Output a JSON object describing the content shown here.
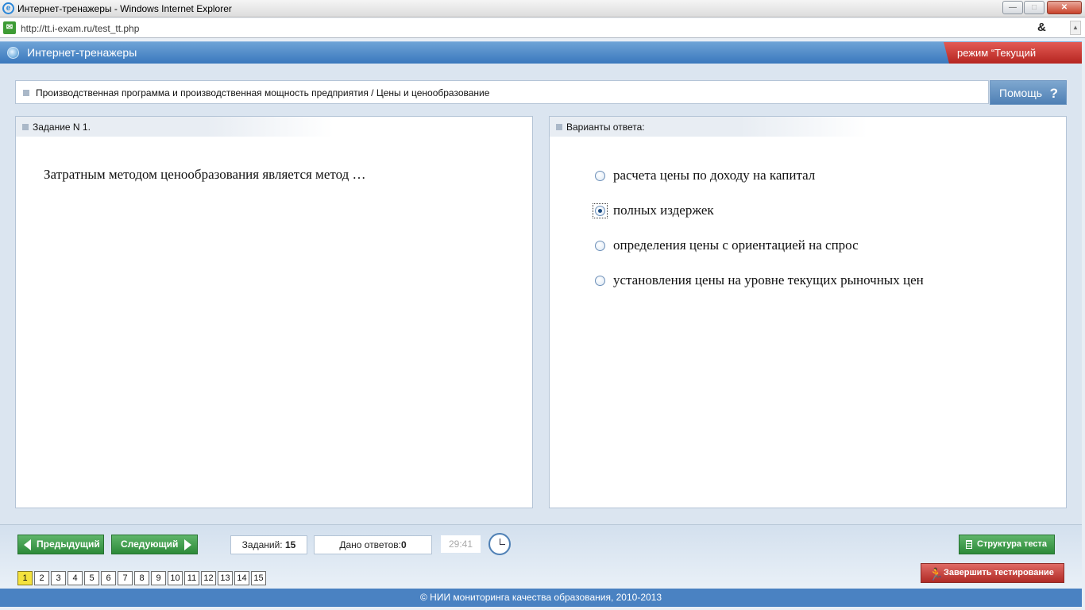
{
  "window": {
    "title": "Интернет-тренажеры - Windows Internet Explorer",
    "min": "—",
    "max": "□",
    "close": "✕"
  },
  "address": {
    "url": "http://tt.i-exam.ru/test_tt.php"
  },
  "header": {
    "title": "Интернет-тренажеры",
    "mode": "режим “Текущий контроль”"
  },
  "breadcrumb": {
    "text": "Производственная программа и производственная мощность предприятия / Цены и ценообразование"
  },
  "help": {
    "label": "Помощь",
    "icon": "?"
  },
  "question_panel": {
    "title": "Задание N 1.",
    "text": "Затратным методом ценообразования является метод …"
  },
  "answers_panel": {
    "title": "Варианты ответа:",
    "options": [
      {
        "label": "расчета цены по доходу на капитал",
        "selected": false
      },
      {
        "label": "полных издержек",
        "selected": true
      },
      {
        "label": "определения цены с ориентацией на спрос",
        "selected": false
      },
      {
        "label": "установления цены на уровне текущих рыночных цен",
        "selected": false
      }
    ]
  },
  "nav": {
    "prev_label": "Предыдущий",
    "next_label": "Следующий",
    "tasks_label": "Заданий:",
    "tasks_count": "15",
    "answers_label": "Дано ответов:",
    "answers_count": "0",
    "timer": "29:41",
    "structure_label": "Структура теста",
    "finish_label": "Завершить тестирование",
    "pages": [
      "1",
      "2",
      "3",
      "4",
      "5",
      "6",
      "7",
      "8",
      "9",
      "10",
      "11",
      "12",
      "13",
      "14",
      "15"
    ],
    "current_page": "1"
  },
  "footer": {
    "text": "© НИИ мониторинга качества образования, 2010-2013"
  },
  "colors": {
    "header_blue": "#3a78bd",
    "mode_red": "#b52520",
    "nav_green": "#2c8a39",
    "current_page_yellow": "#f4e23e"
  },
  "icons": {
    "browser": "ie-icon",
    "page": "page-icon",
    "app": "globe-icon",
    "timer": "clock-icon",
    "structure": "document-icon",
    "finish": "runner-icon"
  }
}
